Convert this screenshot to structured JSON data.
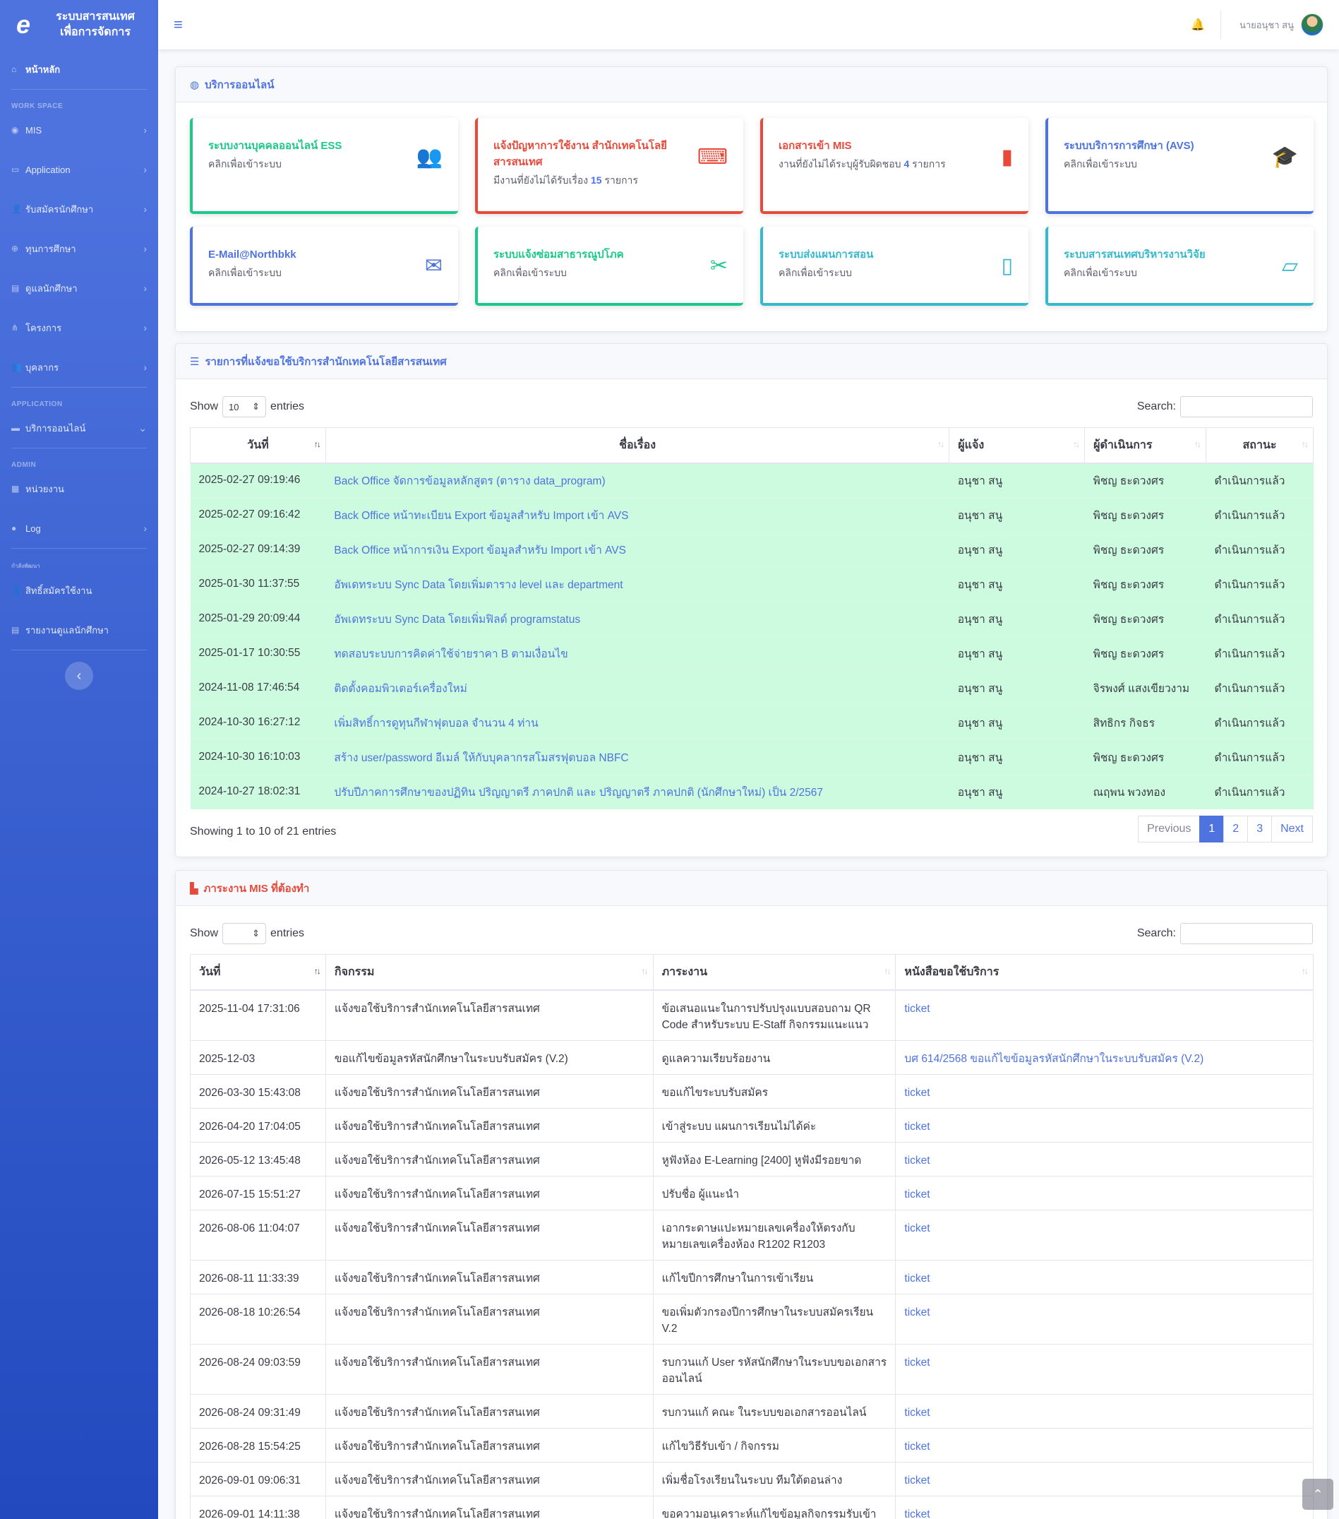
{
  "sidebar": {
    "brand_line1": "ระบบสารสนเทศ",
    "brand_line2": "เพื่อการจัดการ",
    "logo_glyph": "e",
    "dashboard": "หน้าหลัก",
    "heading_workspace": "WORK SPACE",
    "items_workspace": [
      "MIS",
      "Application",
      "รับสมัครนักศึกษา",
      "ทุนการศึกษา",
      "ดูแลนักศึกษา",
      "โครงการ",
      "บุคลากร"
    ],
    "heading_application": "APPLICATION",
    "online_services": "บริการออนไลน์",
    "heading_admin": "ADMIN",
    "units": "หน่วยงาน",
    "log": "Log",
    "heading_dev": "กำลังพัฒนา",
    "permissions": "สิทธิ์สมัครใช้งาน",
    "student_report": "รายงานดูแลนักศึกษา"
  },
  "topbar": {
    "user_name": "นายอนุชา สนู"
  },
  "services": {
    "title": "บริการออนไลน์",
    "items": [
      {
        "title": "ระบบงานบุคคลออนไลน์ ESS",
        "subtitle": "คลิกเพื่อเข้าระบบ",
        "icon": "users-icon",
        "color": "#1cc88a"
      },
      {
        "title": "แจ้งปัญหาการใช้งาน สำนักเทคโนโลยีสารสนเทศ",
        "subtitle_prefix": "มีงานที่ยังไม่ได้รับเรื่อง",
        "count": "15",
        "subtitle_suffix": "รายการ",
        "icon": "laptop-code-icon",
        "color": "#e74a3b"
      },
      {
        "title": "เอกสารเข้า MIS",
        "subtitle_prefix": "งานที่ยังไม่ได้ระบุผู้รับผิดชอบ",
        "count": "4",
        "subtitle_suffix": "รายการ",
        "icon": "file-icon",
        "color": "#e74a3b"
      },
      {
        "title": "ระบบบริการการศึกษา (AVS)",
        "subtitle": "คลิกเพื่อเข้าระบบ",
        "icon": "graduate-icon",
        "color": "#4e73df"
      },
      {
        "title": "E-Mail@Northbkk",
        "subtitle": "คลิกเพื่อเข้าระบบ",
        "icon": "envelope-icon",
        "color": "#4e73df"
      },
      {
        "title": "ระบบแจ้งซ่อมสาธารณูปโภค",
        "subtitle": "คลิกเพื่อเข้าระบบ",
        "icon": "tools-icon",
        "color": "#1cc88a"
      },
      {
        "title": "ระบบส่งแผนการสอน",
        "subtitle": "คลิกเพื่อเข้าระบบ",
        "icon": "book-icon",
        "color": "#36b9cc"
      },
      {
        "title": "ระบบสารสนเทศบริหารงานวิจัย",
        "subtitle": "คลิกเพื่อเข้าระบบ",
        "icon": "folder-open-icon",
        "color": "#36b9cc"
      }
    ]
  },
  "requests": {
    "title": "รายการที่แจ้งขอใช้บริการสำนักเทคโนโลยีสารสนเทศ",
    "show_label": "Show",
    "entries_label": "entries",
    "page_size": "10",
    "search_label": "Search:",
    "columns": [
      "วันที่",
      "ชื่อเรื่อง",
      "ผู้แจ้ง",
      "ผู้ดำเนินการ",
      "สถานะ"
    ],
    "rows": [
      {
        "date": "2025-02-27 09:19:46",
        "subject": "Back Office จัดการข้อมูลหลักสูตร (ตาราง data_program)",
        "reporter": "อนุชา สนู",
        "handler": "พิชญ ธะดวงศร",
        "status": "ดำเนินการแล้ว"
      },
      {
        "date": "2025-02-27 09:16:42",
        "subject": "Back Office หน้าทะเบียน Export ข้อมูลสำหรับ Import เข้า AVS",
        "reporter": "อนุชา สนู",
        "handler": "พิชญ ธะดวงศร",
        "status": "ดำเนินการแล้ว"
      },
      {
        "date": "2025-02-27 09:14:39",
        "subject": "Back Office หน้าการเงิน Export ข้อมูลสำหรับ Import เข้า AVS",
        "reporter": "อนุชา สนู",
        "handler": "พิชญ ธะดวงศร",
        "status": "ดำเนินการแล้ว"
      },
      {
        "date": "2025-01-30 11:37:55",
        "subject": "อัพเดทระบบ Sync Data โดยเพิ่มตาราง level และ department",
        "reporter": "อนุชา สนู",
        "handler": "พิชญ ธะดวงศร",
        "status": "ดำเนินการแล้ว"
      },
      {
        "date": "2025-01-29 20:09:44",
        "subject": "อัพเดทระบบ Sync Data โดยเพิ่มฟิลด์ programstatus",
        "reporter": "อนุชา สนู",
        "handler": "พิชญ ธะดวงศร",
        "status": "ดำเนินการแล้ว"
      },
      {
        "date": "2025-01-17 10:30:55",
        "subject": "ทดสอบระบบการคิดค่าใช้จ่ายราคา B ตามเงื่อนไข",
        "reporter": "อนุชา สนู",
        "handler": "พิชญ ธะดวงศร",
        "status": "ดำเนินการแล้ว"
      },
      {
        "date": "2024-11-08 17:46:54",
        "subject": "ติดตั้งคอมพิวเตอร์เครื่องใหม่",
        "reporter": "อนุชา สนู",
        "handler": "จิรพงศ์ แสงเขียวงาม",
        "status": "ดำเนินการแล้ว"
      },
      {
        "date": "2024-10-30 16:27:12",
        "subject": "เพิ่มสิทธิ์การดูทุนกีฬาฟุตบอล จำนวน 4 ท่าน",
        "reporter": "อนุชา สนู",
        "handler": "สิทธิกร กิจธร",
        "status": "ดำเนินการแล้ว"
      },
      {
        "date": "2024-10-30 16:10:03",
        "subject": "สร้าง user/password อีเมล์ ให้กับบุคลากรสโมสรฟุตบอล NBFC",
        "reporter": "อนุชา สนู",
        "handler": "พิชญ ธะดวงศร",
        "status": "ดำเนินการแล้ว"
      },
      {
        "date": "2024-10-27 18:02:31",
        "subject": "ปรับปีภาคการศึกษาของปฏิทิน ปริญญาตรี ภาคปกติ และ ปริญญาตรี ภาคปกติ (นักศึกษาใหม่) เป็น 2/2567",
        "reporter": "อนุชา สนู",
        "handler": "ณฤพน พวงทอง",
        "status": "ดำเนินการแล้ว"
      }
    ],
    "info": "Showing 1 to 10 of 21 entries",
    "pagination": {
      "previous": "Previous",
      "pages": [
        "1",
        "2",
        "3"
      ],
      "next": "Next"
    }
  },
  "mis": {
    "title": "ภาระงาน MIS ที่ต้องทำ",
    "show_label": "Show",
    "entries_label": "entries",
    "search_label": "Search:",
    "columns": [
      "วันที่",
      "กิจกรรม",
      "ภาระงาน",
      "หนังสือขอใช้บริการ"
    ],
    "rows": [
      {
        "date": "2025-11-04 17:31:06",
        "activity": "แจ้งขอใช้บริการสำนักเทคโนโลยีสารสนเทศ",
        "task": "ข้อเสนอแนะในการปรับปรุงแบบสอบถาม QR Code สำหรับระบบ E-Staff กิจกรรมแนะแนว",
        "doc": "ticket"
      },
      {
        "date": "2025-12-03",
        "activity": "ขอแก้ไขข้อมูลรหัสนักศึกษาในระบบรับสมัคร (V.2)",
        "task": "ดูแลความเรียบร้อยงาน",
        "doc": "บศ 614/2568 ขอแก้ไขข้อมูลรหัสนักศึกษาในระบบรับสมัคร (V.2)"
      },
      {
        "date": "2026-03-30 15:43:08",
        "activity": "แจ้งขอใช้บริการสำนักเทคโนโลยีสารสนเทศ",
        "task": "ขอแก้ไขระบบรับสมัคร",
        "doc": "ticket"
      },
      {
        "date": "2026-04-20 17:04:05",
        "activity": "แจ้งขอใช้บริการสำนักเทคโนโลยีสารสนเทศ",
        "task": "เข้าสู่ระบบ แผนการเรียนไม่ได้ค่ะ",
        "doc": "ticket"
      },
      {
        "date": "2026-05-12 13:45:48",
        "activity": "แจ้งขอใช้บริการสำนักเทคโนโลยีสารสนเทศ",
        "task": "หูฟังห้อง E-Learning [2400] หูฟังมีรอยขาด",
        "doc": "ticket"
      },
      {
        "date": "2026-07-15 15:51:27",
        "activity": "แจ้งขอใช้บริการสำนักเทคโนโลยีสารสนเทศ",
        "task": "ปรับชื่อ ผู้แนะนำ",
        "doc": "ticket"
      },
      {
        "date": "2026-08-06 11:04:07",
        "activity": "แจ้งขอใช้บริการสำนักเทคโนโลยีสารสนเทศ",
        "task": "เอากระดาษแปะหมายเลขเครื่องให้ตรงกับหมายเลขเครื่องห้อง R1202 R1203",
        "doc": "ticket"
      },
      {
        "date": "2026-08-11 11:33:39",
        "activity": "แจ้งขอใช้บริการสำนักเทคโนโลยีสารสนเทศ",
        "task": "แก้ไขปีการศึกษาในการเข้าเรียน",
        "doc": "ticket"
      },
      {
        "date": "2026-08-18 10:26:54",
        "activity": "แจ้งขอใช้บริการสำนักเทคโนโลยีสารสนเทศ",
        "task": "ขอเพิ่มตัวกรองปีการศึกษาในระบบสมัครเรียน V.2",
        "doc": "ticket"
      },
      {
        "date": "2026-08-24 09:03:59",
        "activity": "แจ้งขอใช้บริการสำนักเทคโนโลยีสารสนเทศ",
        "task": "รบกวนแก้ User รหัสนักศึกษาในระบบขอเอกสารออนไลน์",
        "doc": "ticket"
      },
      {
        "date": "2026-08-24 09:31:49",
        "activity": "แจ้งขอใช้บริการสำนักเทคโนโลยีสารสนเทศ",
        "task": "รบกวนแก้ คณะ ในระบบขอเอกสารออนไลน์",
        "doc": "ticket"
      },
      {
        "date": "2026-08-28 15:54:25",
        "activity": "แจ้งขอใช้บริการสำนักเทคโนโลยีสารสนเทศ",
        "task": "แก้ไขวิธีรับเข้า / กิจกรรม",
        "doc": "ticket"
      },
      {
        "date": "2026-09-01 09:06:31",
        "activity": "แจ้งขอใช้บริการสำนักเทคโนโลยีสารสนเทศ",
        "task": "เพิ่มชื่อโรงเรียนในระบบ ทีมใต้ตอนล่าง",
        "doc": "ticket"
      },
      {
        "date": "2026-09-01 14:11:38",
        "activity": "แจ้งขอใช้บริการสำนักเทคโนโลยีสารสนเทศ",
        "task": "ขอความอนุเคราะห์แก้ไขข้อมูลกิจกรรมรับเข้า",
        "doc": "ticket"
      }
    ]
  }
}
